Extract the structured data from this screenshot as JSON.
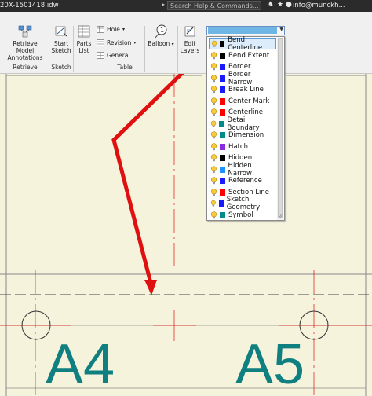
{
  "titlebar": {
    "filename": "20X-1501418.idw",
    "search_placeholder": "Search Help & Commands...",
    "user": "info@munckh..."
  },
  "ribbon": {
    "retrieve": {
      "button_label_1": "Retrieve Model",
      "button_label_2": "Annotations",
      "panel_label": "Retrieve"
    },
    "sketch": {
      "button_label_1": "Start",
      "button_label_2": "Sketch",
      "panel_label": "Sketch"
    },
    "table": {
      "parts_list_1": "Parts",
      "parts_list_2": "List",
      "hole": "Hole",
      "revision": "Revision",
      "general": "General",
      "panel_label": "Table"
    },
    "balloon": {
      "label": "Balloon"
    },
    "edit_layers": {
      "label_1": "Edit",
      "label_2": "Layers"
    }
  },
  "layer_dropdown": {
    "items": [
      {
        "label": "Bend Centerline",
        "color": "#000000",
        "selected": true
      },
      {
        "label": "Bend Extent",
        "color": "#000000"
      },
      {
        "label": "Border",
        "color": "#1a1aff"
      },
      {
        "label": "Border Narrow",
        "color": "#1a1aff"
      },
      {
        "label": "Break Line",
        "color": "#1a1aff"
      },
      {
        "label": "Center Mark",
        "color": "#ff0000"
      },
      {
        "label": "Centerline",
        "color": "#ff0000"
      },
      {
        "label": "Detail Boundary",
        "color": "#008b8b"
      },
      {
        "label": "Dimension",
        "color": "#008b8b"
      },
      {
        "label": "Hatch",
        "color": "#8a2be2"
      },
      {
        "label": "Hidden",
        "color": "#000000"
      },
      {
        "label": "Hidden Narrow",
        "color": "#1e90ff"
      },
      {
        "label": "Reference",
        "color": "#1a1aff"
      },
      {
        "label": "Section Line",
        "color": "#ff0000"
      },
      {
        "label": "Sketch Geometry",
        "color": "#1a1aff"
      },
      {
        "label": "Symbol",
        "color": "#008b8b"
      }
    ]
  },
  "drawing": {
    "label_left": "A4",
    "label_right": "A5",
    "accent_annotation": "#e01010",
    "label_color": "#0f7f7f"
  }
}
